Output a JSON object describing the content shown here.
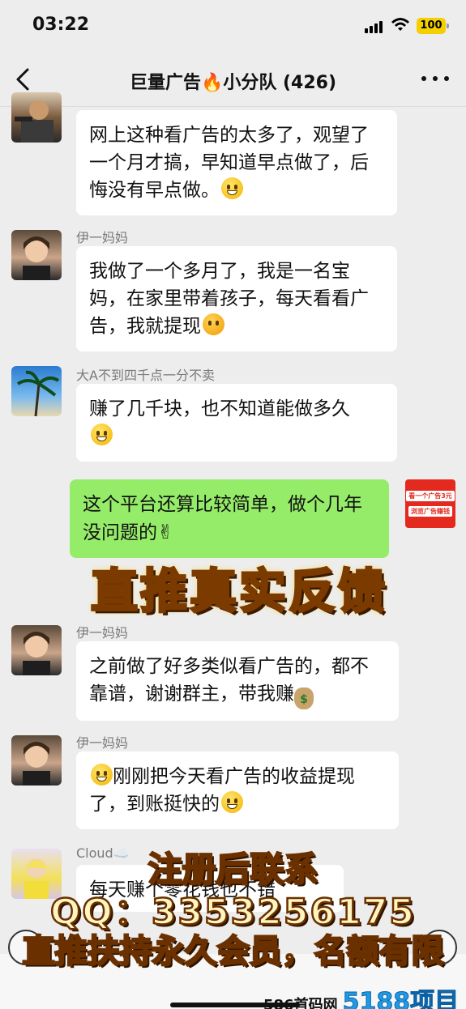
{
  "status_bar": {
    "time": "03:22",
    "battery": "100"
  },
  "header": {
    "title": "巨量广告🔥小分队 (426)"
  },
  "messages": [
    {
      "sender": "",
      "text": "网上这种看广告的太多了，观望了一个月才搞，早知道早点做了，后悔没有早点做。",
      "emoji": "😓"
    },
    {
      "sender": "伊一妈妈",
      "text": "我做了一个多月了，我是一名宝妈，在家里带着孩子，每天看看广告，我就提现",
      "emoji": "🤭"
    },
    {
      "sender": "大A不到四千点一分不卖",
      "text": "赚了几千块，也不知道能做多久",
      "emoji": "😁"
    },
    {
      "sender": "",
      "text": "这个平台还算比较简单，做个几年没问题的",
      "emoji": "✌️"
    },
    {
      "sender": "伊一妈妈",
      "text": "之前做了好多类似看广告的，都不靠谱，谢谢群主，带我赚",
      "emoji": "💰"
    },
    {
      "sender": "伊一妈妈",
      "text": "刚刚把今天看广告的收益提现了，到账挺快的",
      "emoji": "😁"
    },
    {
      "sender": "Cloud☁️",
      "text": "每天赚个零花钱也不错",
      "emoji": ""
    }
  ],
  "ad_badge": {
    "line1": "看一个广告3元",
    "line2": "浏览广告赚钱"
  },
  "banner": {
    "text": "直推真实反馈"
  },
  "overlay": {
    "line1": "注册后联系",
    "line2": "QQ：3353256175",
    "line3": "直推扶持永久会员，名额有限"
  },
  "watermark": {
    "left": "586首码网",
    "right": "5188项目网"
  }
}
